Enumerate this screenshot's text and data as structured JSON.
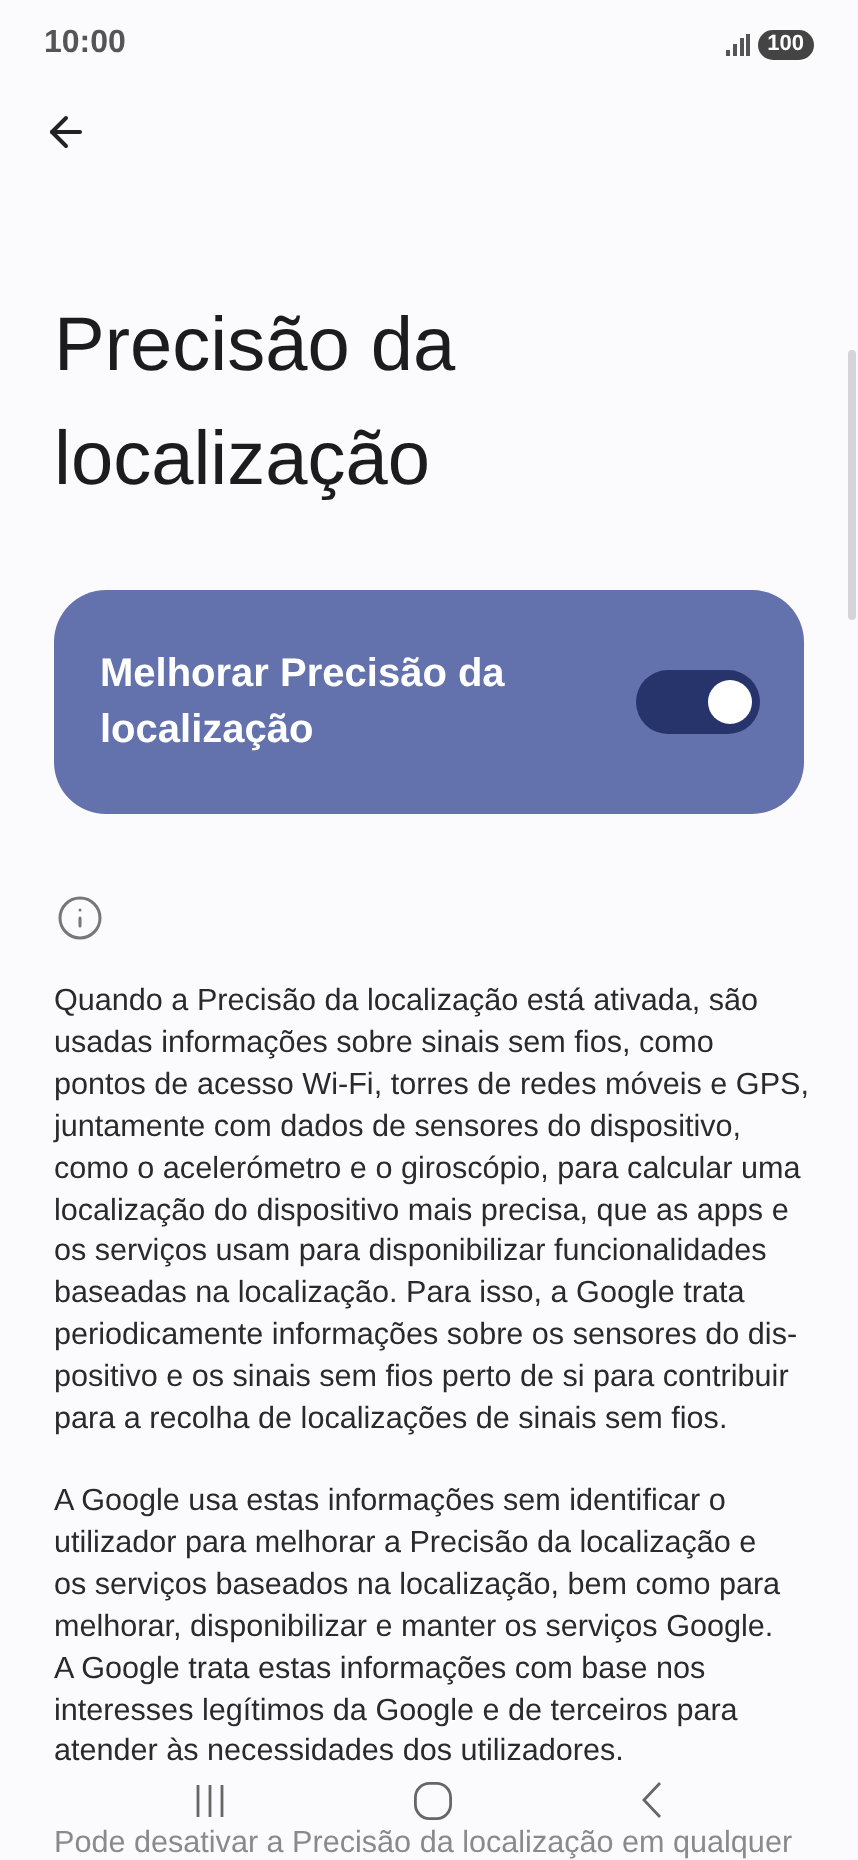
{
  "status_bar": {
    "time": "10:00",
    "battery": "100"
  },
  "title": "Precisão da localização",
  "toggle_card": {
    "label": "Melhorar Precisão da localização",
    "on": true
  },
  "paragraphs": [
    [
      "Quando a Precisão da localização está ativada, são",
      "usadas informações sobre sinais sem fios, como",
      "pontos de acesso Wi-Fi, torres de redes móveis e GPS,",
      "juntamente com dados de sensores do dispositivo,",
      "como o acelerómetro e o giroscópio, para calcular uma",
      "localização do dispositivo mais precisa, que as apps e",
      "os serviços usam para disponibilizar funcionalidades",
      "baseadas na localização. Para isso, a Google trata",
      "periodicamente informações sobre os sensores do dis-",
      "positivo e os sinais sem fios perto de si para contribuir",
      "para a recolha de localizações de sinais sem fios."
    ],
    [
      "A Google usa estas informações sem identificar o",
      "utilizador para melhorar a Precisão da localização e",
      "os serviços baseados na localização, bem como para",
      "melhorar, disponibilizar e manter os serviços Google.",
      "A Google trata estas informações com base nos",
      "interesses legítimos da Google e de terceiros para",
      "atender às necessidades dos utilizadores."
    ],
    [
      "Pode desativar a Precisão da localização em qualquer"
    ]
  ]
}
